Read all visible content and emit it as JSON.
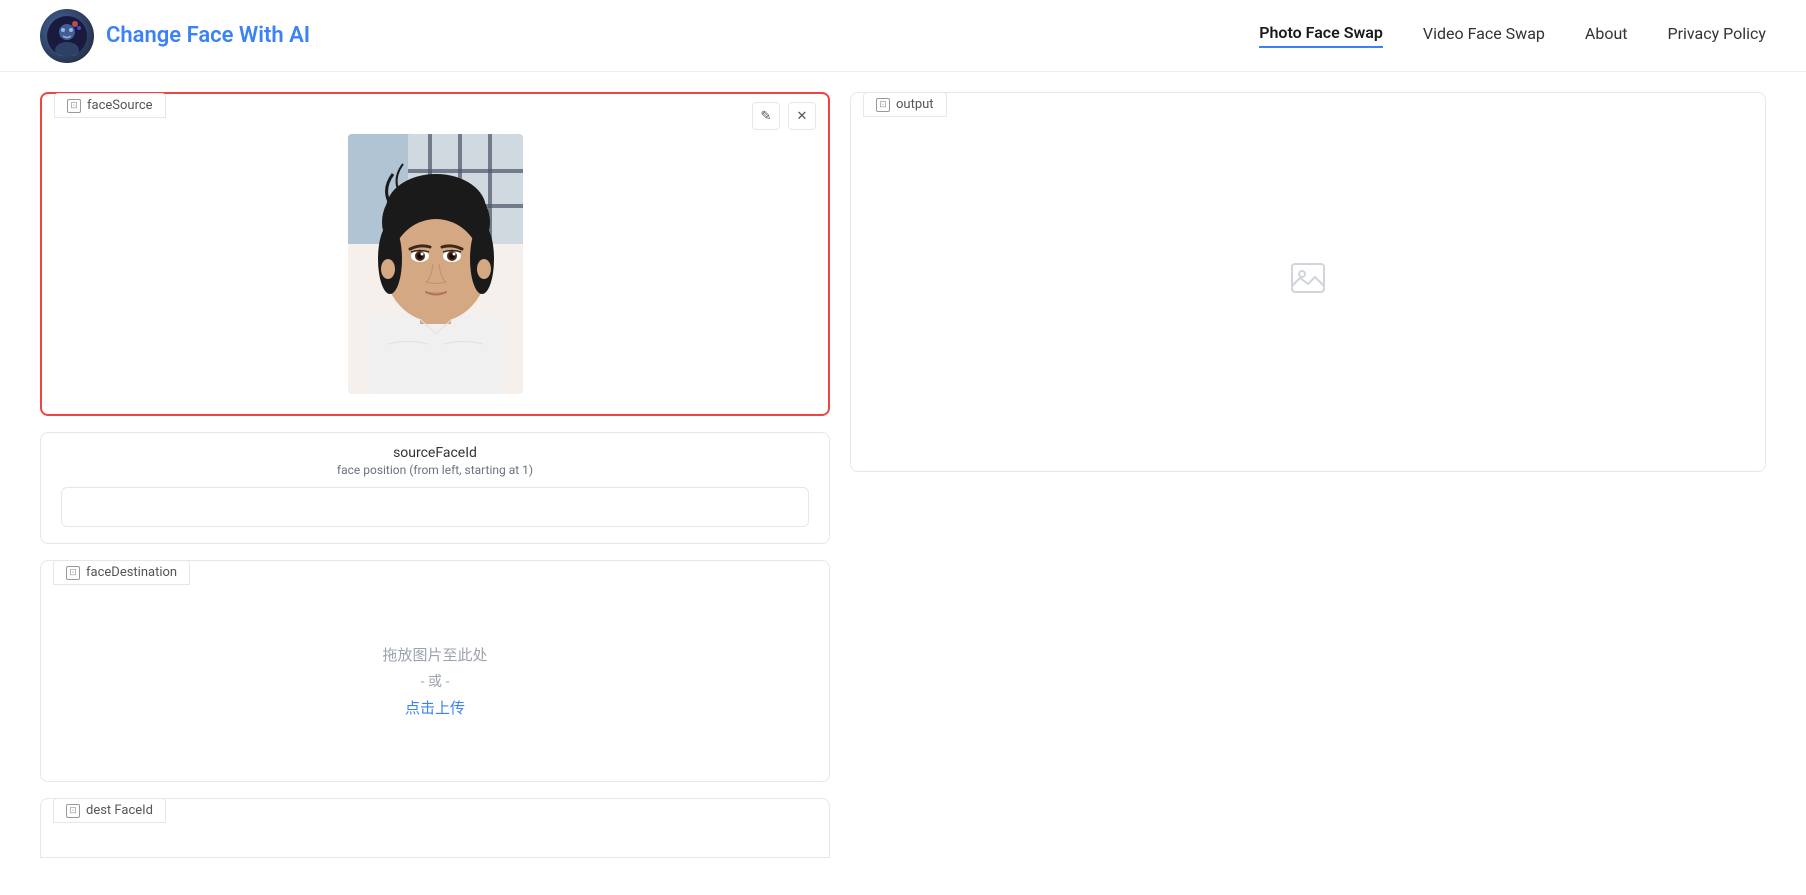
{
  "header": {
    "logo_alt": "Change Face With AI logo",
    "title": "Change Face With AI",
    "nav": [
      {
        "label": "Photo Face Swap",
        "active": true
      },
      {
        "label": "Video Face Swap",
        "active": false
      },
      {
        "label": "About",
        "active": false
      },
      {
        "label": "Privacy Policy",
        "active": false
      }
    ]
  },
  "left": {
    "face_source": {
      "tab_label": "faceSource",
      "edit_icon": "✎",
      "close_icon": "✕"
    },
    "source_face_id": {
      "label": "sourceFaceId",
      "sublabel": "face position (from left, starting at 1)",
      "input_placeholder": "",
      "input_value": ""
    },
    "face_destination": {
      "tab_label": "faceDestination",
      "drop_text": "拖放图片至此处",
      "or_text": "- 或 -",
      "upload_text": "点击上传"
    },
    "bottom_tab_label": "dest FaceId"
  },
  "right": {
    "output": {
      "tab_label": "output",
      "empty_icon": "image-placeholder"
    }
  }
}
